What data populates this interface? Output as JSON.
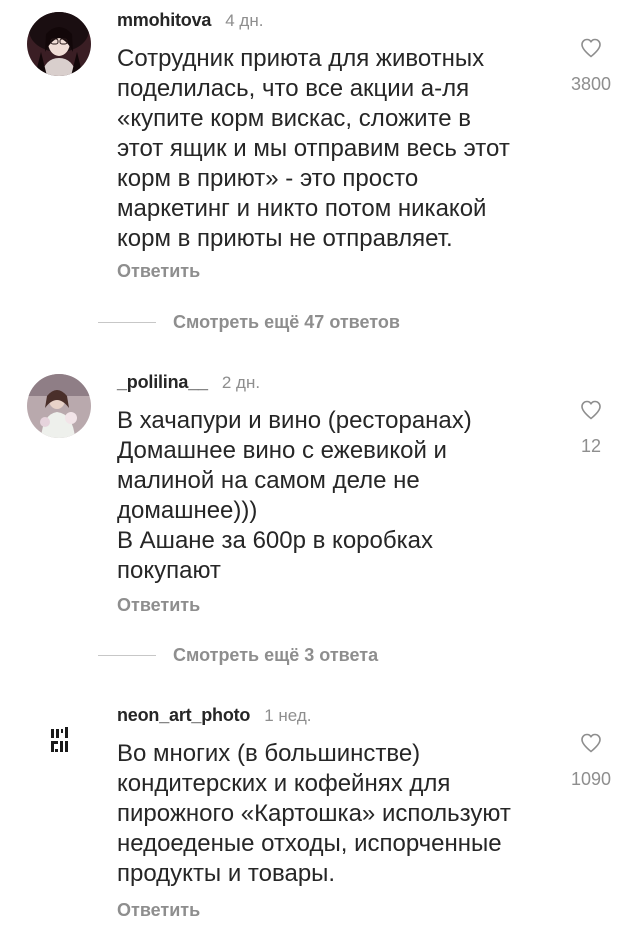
{
  "comments": [
    {
      "username": "mmohitova",
      "time": "4 дн.",
      "text": "Сотрудник приюта для животных\nподелилась, что все акции а-ля\n«купите корм вискас, сложите в\nэтот ящик и мы отправим весь этот\nкорм в приют» - это просто\nмаркетинг и никто потом никакой\nкорм в приюты не отправляет.",
      "likes": "3800",
      "reply_label": "Ответить",
      "view_replies": "Смотреть ещё 47 ответов",
      "avatar_icon": "profile-photo"
    },
    {
      "username": "_polilina__",
      "time": "2 дн.",
      "text": "В хачапури и вино (ресторанах)\nДомашнее вино с ежевикой и\nмалиной на самом деле не\nдомашнее)))\nВ Ашане за 600р в коробках\nпокупают",
      "likes": "12",
      "reply_label": "Ответить",
      "view_replies": "Смотреть ещё 3 ответа",
      "avatar_icon": "profile-photo"
    },
    {
      "username": "neon_art_photo",
      "time": "1 нед.",
      "text": "Во многих (в большинстве)\nкондитерских и кофейнях для\nпирожного «Картошка» используют\nнедоеденые отходы, испорченные\nпродукты и товары.",
      "likes": "1090",
      "reply_label": "Ответить",
      "avatar_icon": "logo-mark"
    }
  ],
  "colors": {
    "text": "#262626",
    "secondary": "#8e8e8e",
    "divider": "#c7c7c7",
    "background": "#ffffff"
  },
  "icons": {
    "like": "heart-icon"
  }
}
